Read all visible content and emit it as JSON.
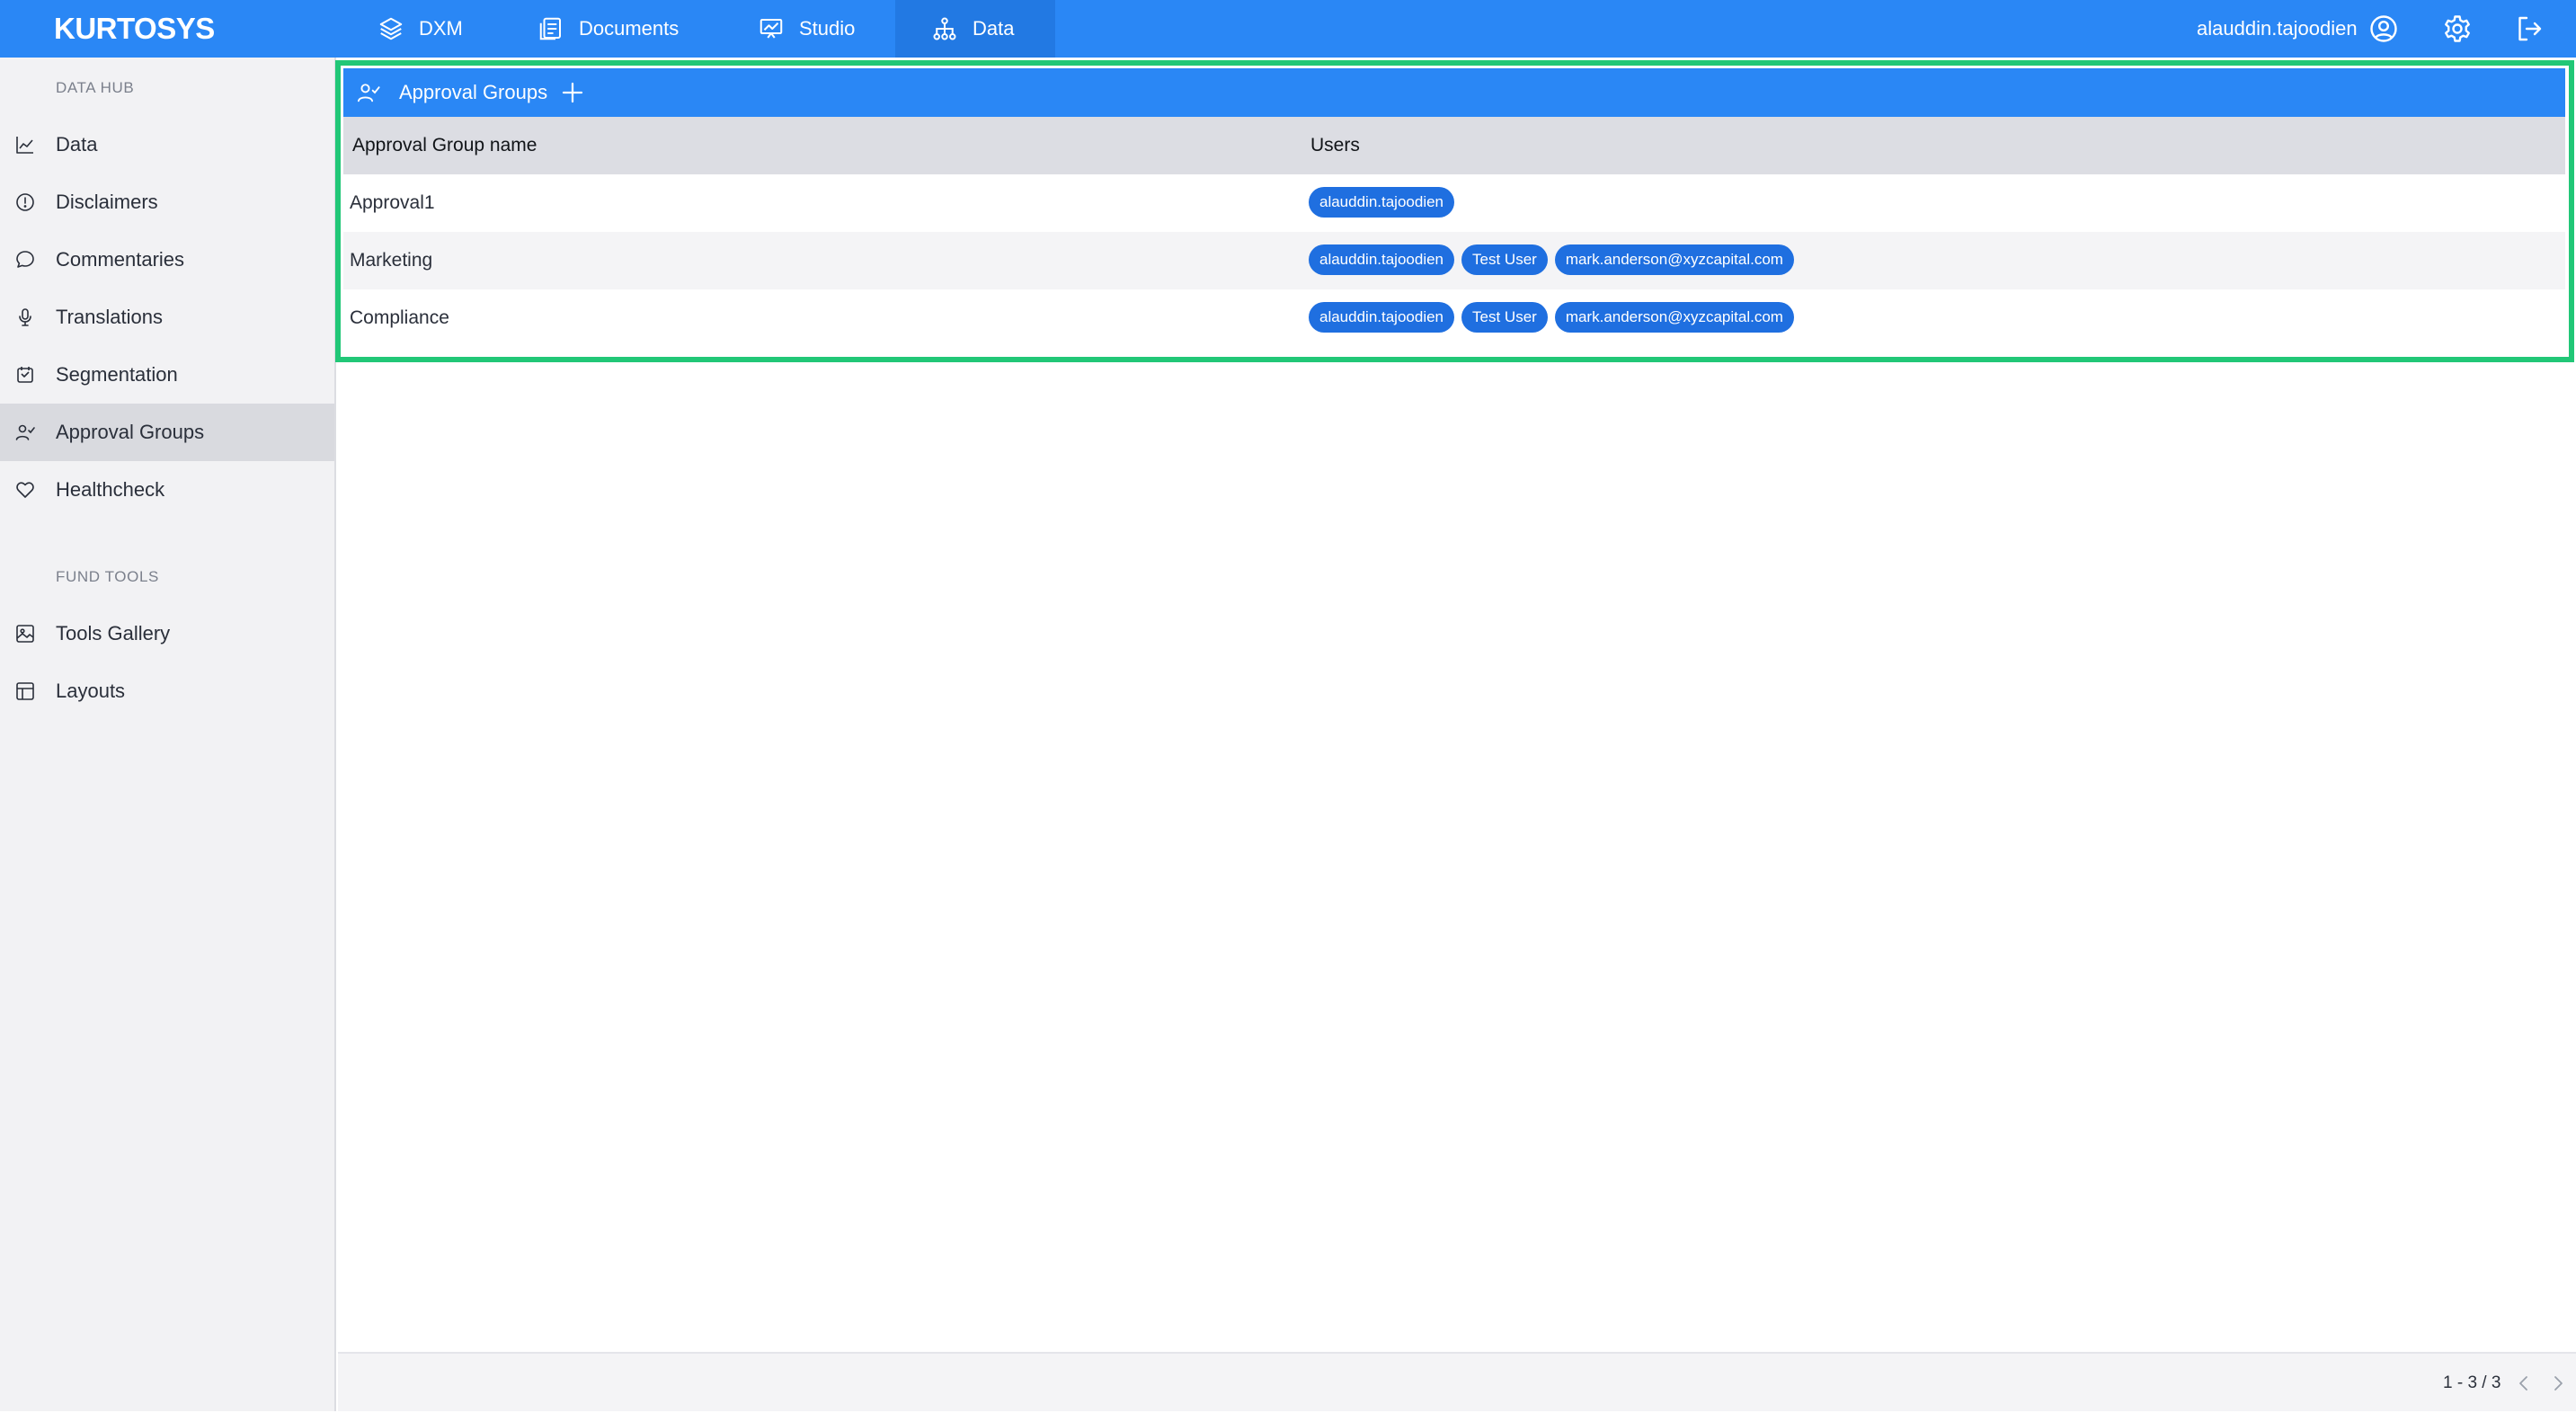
{
  "app": {
    "logo": "KURTOSYS",
    "user_name": "alauddin.tajoodien"
  },
  "topnav": [
    {
      "label": "DXM",
      "icon": "layers-icon",
      "active": false
    },
    {
      "label": "Documents",
      "icon": "documents-icon",
      "active": false
    },
    {
      "label": "Studio",
      "icon": "presentation-icon",
      "active": false
    },
    {
      "label": "Data",
      "icon": "hierarchy-icon",
      "active": true
    }
  ],
  "sidebar": {
    "section_datahub": "DATA HUB",
    "section_fundtools": "FUND TOOLS",
    "items": [
      {
        "label": "Data",
        "icon": "chart-line-icon"
      },
      {
        "label": "Disclaimers",
        "icon": "alert-circle-icon"
      },
      {
        "label": "Commentaries",
        "icon": "comment-icon"
      },
      {
        "label": "Translations",
        "icon": "microphone-icon"
      },
      {
        "label": "Segmentation",
        "icon": "segment-box-icon"
      },
      {
        "label": "Approval Groups",
        "icon": "user-check-icon",
        "active": true
      },
      {
        "label": "Healthcheck",
        "icon": "heart-icon"
      }
    ],
    "fund_items": [
      {
        "label": "Tools Gallery",
        "icon": "image-icon"
      },
      {
        "label": "Layouts",
        "icon": "layout-icon"
      }
    ]
  },
  "panel": {
    "title": "Approval Groups",
    "icon": "user-check-icon",
    "add_icon": "plus-icon"
  },
  "table": {
    "columns": [
      "Approval Group name",
      "Users"
    ],
    "rows": [
      {
        "name": "Approval1",
        "users": [
          "alauddin.tajoodien"
        ]
      },
      {
        "name": "Marketing",
        "users": [
          "alauddin.tajoodien",
          "Test User",
          "mark.anderson@xyzcapital.com"
        ]
      },
      {
        "name": "Compliance",
        "users": [
          "alauddin.tajoodien",
          "Test User",
          "mark.anderson@xyzcapital.com"
        ]
      }
    ]
  },
  "footer": {
    "pagination": "1 - 3 / 3"
  },
  "colors": {
    "brand_blue": "#2a87f5",
    "chip_blue": "#1f6fe0",
    "highlight_green": "#21c777",
    "sidebar_bg": "#f2f2f4"
  }
}
